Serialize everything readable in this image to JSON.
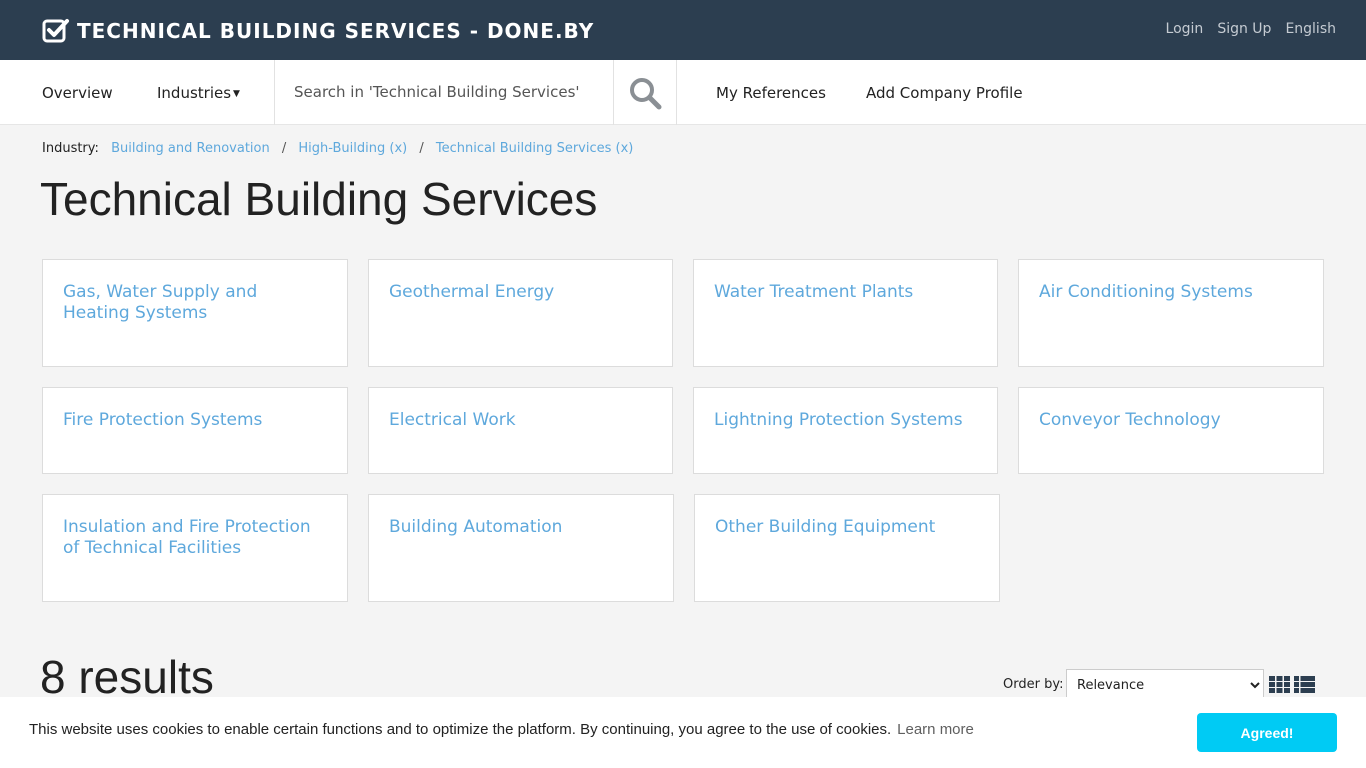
{
  "header": {
    "brand": "TECHNICAL BUILDING SERVICES - DONE.BY",
    "login": "Login",
    "signup": "Sign Up",
    "language": "English"
  },
  "nav": {
    "overview": "Overview",
    "industries": "Industries",
    "search_placeholder": "Search in 'Technical Building Services'",
    "my_references": "My References",
    "add_company_profile": "Add Company Profile"
  },
  "breadcrumb": {
    "label": "Industry:",
    "items": [
      "Building and Renovation",
      "High-Building (x)",
      "Technical Building Services (x)"
    ]
  },
  "page_title": "Technical Building Services",
  "categories": [
    "Gas, Water Supply and Heating Systems",
    "Geothermal Energy",
    "Water Treatment Plants",
    "Air Conditioning Systems",
    "Fire Protection Systems",
    "Electrical Work",
    "Lightning Protection Systems",
    "Conveyor Technology",
    "Insulation and Fire Protection of Technical Facilities",
    "Building Automation",
    "Other Building Equipment"
  ],
  "results": {
    "count_text": "8 results",
    "order_label": "Order by:",
    "order_selected": "Relevance"
  },
  "cookie": {
    "text": "This website uses cookies to enable certain functions and to optimize the platform. By continuing, you agree to the use of cookies.",
    "learn_more": "Learn more",
    "agree": "Agreed!"
  },
  "colors": {
    "topbar": "#2c3e50",
    "link": "#5ea8dc",
    "cookie_button": "#00cbf4"
  }
}
